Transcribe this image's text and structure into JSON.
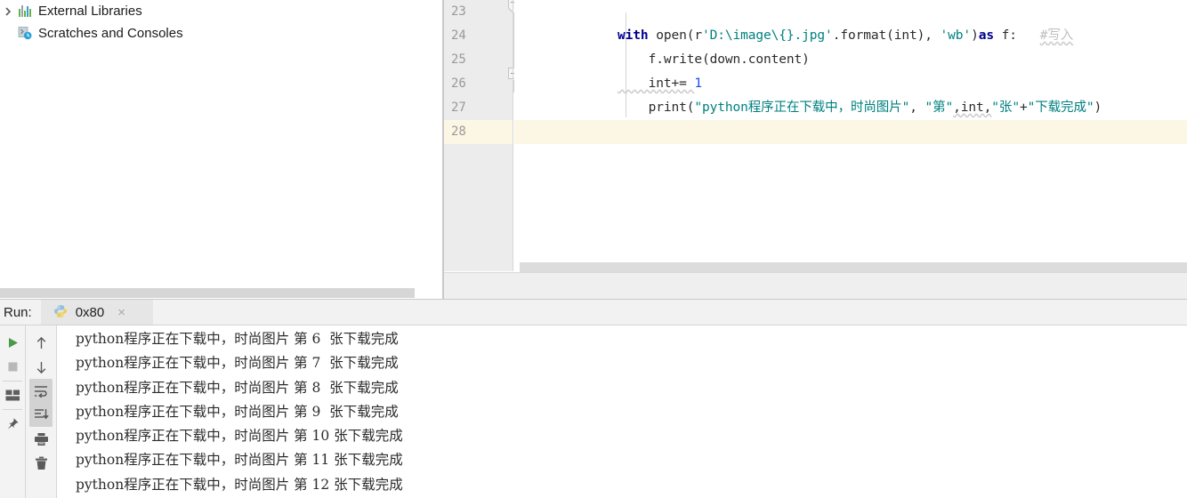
{
  "project_panel": {
    "items": [
      {
        "label": "External Libraries",
        "icon": "library-bars-icon",
        "expandable": true,
        "arrow": "chevron-right-icon"
      },
      {
        "label": "Scratches and Consoles",
        "icon": "scratches-clock-icon",
        "expandable": false,
        "arrow": ""
      }
    ]
  },
  "editor": {
    "line_numbers": [
      "23",
      "24",
      "25",
      "26",
      "27",
      "28"
    ],
    "current_line": "28",
    "lines": [
      {
        "number": "23",
        "tokens": [
          {
            "text": "with ",
            "type": "keyword"
          },
          {
            "text": "open(r",
            "type": "plain"
          },
          {
            "text": "'D:\\image\\{}.jpg'",
            "type": "string"
          },
          {
            "text": ".format(int), ",
            "type": "plain"
          },
          {
            "text": "'wb'",
            "type": "string"
          },
          {
            "text": ")",
            "type": "plain"
          },
          {
            "text": "as ",
            "type": "keyword"
          },
          {
            "text": "f:   ",
            "type": "plain"
          },
          {
            "text": "#写入",
            "type": "comment"
          }
        ]
      },
      {
        "number": "24",
        "tokens": [
          {
            "text": "    f.write(down.content)",
            "type": "plain"
          }
        ]
      },
      {
        "number": "25",
        "tokens": [
          {
            "text": "    int+= ",
            "type": "plain"
          },
          {
            "text": "1",
            "type": "number"
          }
        ]
      },
      {
        "number": "26",
        "tokens": [
          {
            "text": "    print(",
            "type": "plain"
          },
          {
            "text": "\"python程序正在下载中，时尚图片\"",
            "type": "string"
          },
          {
            "text": ", ",
            "type": "plain"
          },
          {
            "text": "\"第\"",
            "type": "string"
          },
          {
            "text": ",int,",
            "type": "plain"
          },
          {
            "text": "\"张\"",
            "type": "string"
          },
          {
            "text": "+",
            "type": "plain"
          },
          {
            "text": "\"下载完成\"",
            "type": "string"
          },
          {
            "text": ")",
            "type": "plain"
          }
        ]
      },
      {
        "number": "27",
        "tokens": []
      },
      {
        "number": "28",
        "tokens": []
      }
    ],
    "colors": {
      "keyword": "#00008f",
      "string": "#008080",
      "number": "#1750eb",
      "comment": "#bfbfbf",
      "plain": "#2b2b2b",
      "current_line_bg": "#fcf7e4",
      "gutter_bg": "#ececec"
    }
  },
  "run_window": {
    "label": "Run:",
    "tab": {
      "icon": "python-icon",
      "title": "0x80",
      "close": "×"
    },
    "toolbar_left": [
      {
        "name": "rerun-button",
        "icon": "play-icon",
        "color": "#4a9a4a",
        "active": false
      },
      {
        "name": "stop-button",
        "icon": "stop-square-icon",
        "color": "#b0b0b0",
        "active": false
      },
      {
        "name": "divider-1",
        "icon": "divider",
        "color": "",
        "active": false
      },
      {
        "name": "restore-layout-button",
        "icon": "layout-icon",
        "color": "#5a5a5a",
        "active": false
      },
      {
        "name": "divider-2",
        "icon": "divider",
        "color": "",
        "active": false
      },
      {
        "name": "pin-tab-button",
        "icon": "pin-icon",
        "color": "#5a5a5a",
        "active": false
      }
    ],
    "toolbar_right": [
      {
        "name": "up-the-stack-trace-button",
        "icon": "arrow-up-icon",
        "color": "#5a5a5a",
        "active": false
      },
      {
        "name": "down-the-stack-trace-button",
        "icon": "arrow-down-icon",
        "color": "#5a5a5a",
        "active": false
      },
      {
        "name": "soft-wrap-button",
        "icon": "soft-wrap-icon",
        "color": "#5a5a5a",
        "active": true
      },
      {
        "name": "scroll-to-end-button",
        "icon": "scroll-to-end-icon",
        "color": "#5a5a5a",
        "active": true
      },
      {
        "name": "print-button",
        "icon": "printer-icon",
        "color": "#5a5a5a",
        "active": false
      },
      {
        "name": "clear-all-button",
        "icon": "trash-icon",
        "color": "#5a5a5a",
        "active": false
      }
    ],
    "console_output": [
      "python程序正在下载中，时尚图片 第 6  张下载完成",
      "python程序正在下载中，时尚图片 第 7  张下载完成",
      "python程序正在下载中，时尚图片 第 8  张下载完成",
      "python程序正在下载中，时尚图片 第 9  张下载完成",
      "python程序正在下载中，时尚图片 第 10 张下载完成",
      "python程序正在下载中，时尚图片 第 11 张下载完成",
      "python程序正在下载中，时尚图片 第 12 张下载完成"
    ]
  }
}
